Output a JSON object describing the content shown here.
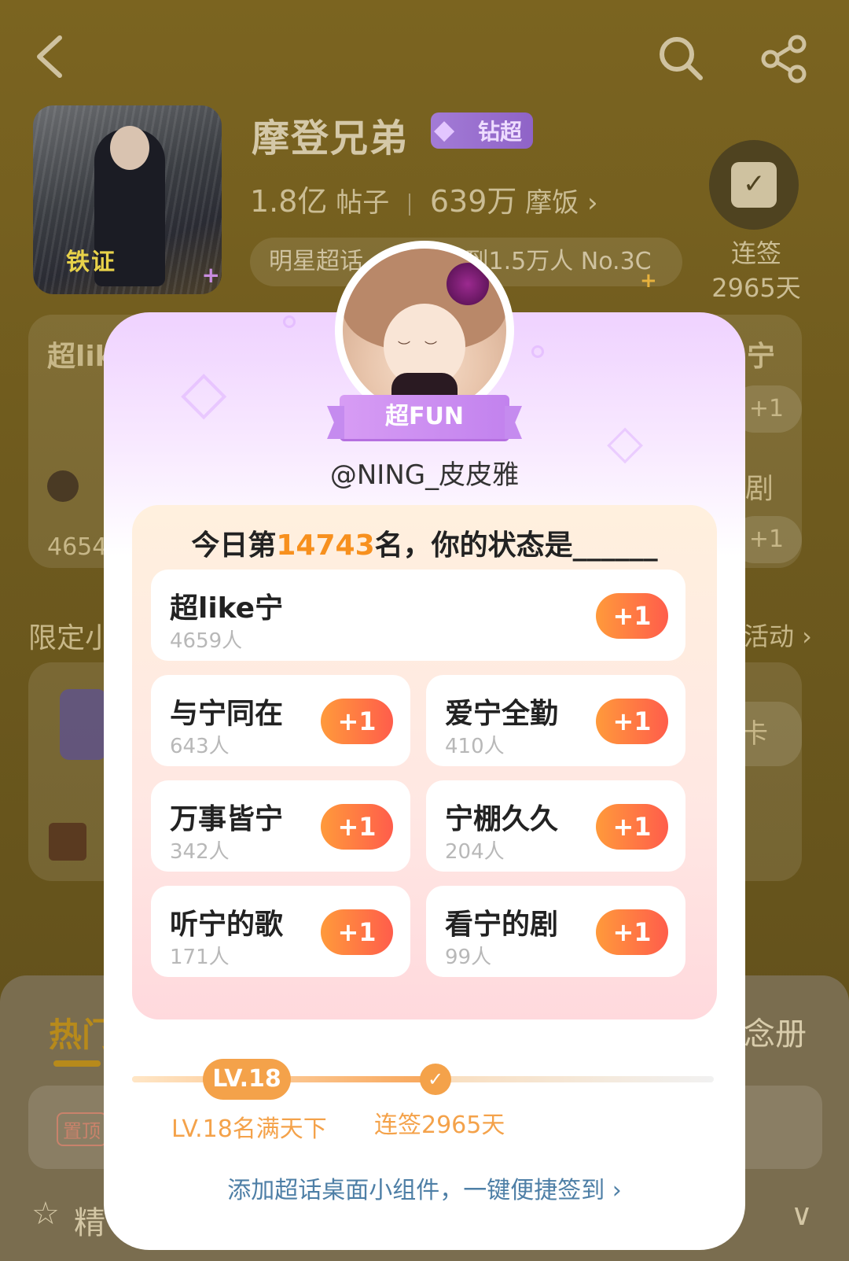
{
  "topbar": {
    "back_icon": "back-arrow-icon",
    "search_icon": "search-icon",
    "share_icon": "share-icon"
  },
  "topic": {
    "title": "摩登兄弟",
    "badge": "钻超",
    "posts_value": "1.8亿",
    "posts_label": "帖子",
    "fans_value": "639万",
    "fans_label": "摩饭",
    "fans_chevron": "›",
    "tag_chip": "明星超话",
    "tag_chip_extra": "签到1.5万人 No.3C",
    "cover_text": "铁证"
  },
  "checkin": {
    "label_line1": "连签",
    "label_line2": "2965天"
  },
  "background": {
    "card1_left": "超lik",
    "card1_right": "宁",
    "card1_plus": "+1",
    "card1_plus2": "+1",
    "card1_count": "4654",
    "card1_right2": "剧",
    "section_left": "限定小",
    "section_right": "活动 ›",
    "card2_right": "卡",
    "card3_left": "热"
  },
  "bottom_sheet": {
    "hot": "热门",
    "album": "念册",
    "pin": "置顶",
    "essence": "精",
    "chevron": "∨"
  },
  "modal": {
    "ribbon": "超FUN",
    "username": "@NING_皮皮雅",
    "panel": {
      "prefix": "今日第",
      "rank": "14743",
      "suffix": "名，你的状态是______"
    },
    "options": [
      {
        "name": "超like宁",
        "count": "4659人",
        "button": "+1"
      },
      {
        "name": "与宁同在",
        "count": "643人",
        "button": "+1"
      },
      {
        "name": "爱宁全勤",
        "count": "410人",
        "button": "+1"
      },
      {
        "name": "万事皆宁",
        "count": "342人",
        "button": "+1"
      },
      {
        "name": "宁棚久久",
        "count": "204人",
        "button": "+1"
      },
      {
        "name": "听宁的歌",
        "count": "171人",
        "button": "+1"
      },
      {
        "name": "看宁的剧",
        "count": "99人",
        "button": "+1"
      }
    ],
    "level_badge": "LV.18",
    "level_label": "LV.18名满天下",
    "streak_label": "连签2965天",
    "widget_link": "添加超话桌面小组件，一键便捷签到 ›"
  },
  "colors": {
    "accent_orange": "#f7901e",
    "modal_purple": "#c282ee",
    "link_blue": "#4e7fa6"
  }
}
